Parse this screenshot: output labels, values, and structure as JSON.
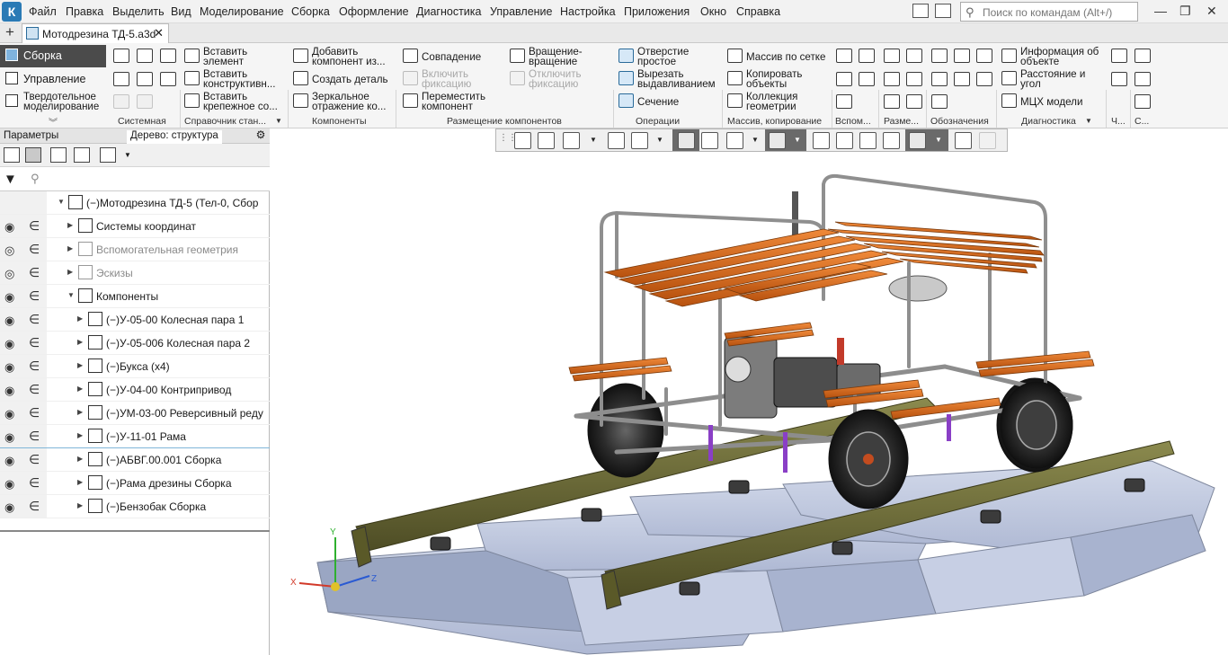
{
  "menubar": {
    "items": [
      "Файл",
      "Правка",
      "Выделить",
      "Вид",
      "Моделирование",
      "Сборка",
      "Оформление",
      "Диагностика",
      "Управление",
      "Настройка",
      "Приложения",
      "Окно",
      "Справка"
    ],
    "search_placeholder": "Поиск по командам (Alt+/)"
  },
  "tabs": {
    "document": "Мотодрезина ТД-5.a3d"
  },
  "modes": {
    "items": [
      "Сборка",
      "Управление",
      "Твердотельное моделирование"
    ]
  },
  "ribbon": {
    "insert_element": "Вставить элемент",
    "insert_construct": "Вставить конструктивн...",
    "insert_fastener": "Вставить крепежное со...",
    "add_component": "Добавить компонент из...",
    "create_part": "Создать деталь",
    "mirror_copy": "Зеркальное отражение ко...",
    "coincidence": "Совпадение",
    "enable_fix": "Включить фиксацию",
    "move_component": "Переместить компонент",
    "rotate": "Вращение-вращение",
    "disable_fix": "Отключить фиксацию",
    "simple_hole": "Отверстие простое",
    "cut_extrude": "Вырезать выдавливанием",
    "section": "Сечение",
    "grid_array": "Массив по сетке",
    "copy_objects": "Копировать объекты",
    "geometry_collection": "Коллекция геометрии",
    "object_info": "Информация об объекте",
    "distance_angle": "Расстояние и угол",
    "mass_props": "МЦХ модели",
    "groups": [
      "Системная",
      "Справочник стан...",
      "Компоненты",
      "Размещение компонентов",
      "Операции",
      "Массив, копирование",
      "Вспом...",
      "Разме...",
      "Обозначения",
      "Диагностика",
      "Ч...",
      "С..."
    ]
  },
  "left_panel": {
    "tab_params": "Параметры",
    "tab_tree": "Дерево: структура",
    "tree": [
      {
        "label": "(−)Мотодрезина ТД-5 (Тел-0, Сбор",
        "level": 0,
        "expanded": true
      },
      {
        "label": "Системы координат",
        "level": 1
      },
      {
        "label": "Вспомогательная геометрия",
        "level": 1,
        "grey": true
      },
      {
        "label": "Эскизы",
        "level": 1,
        "grey": true
      },
      {
        "label": "Компоненты",
        "level": 1,
        "expanded": true
      },
      {
        "label": "(−)У-05-00 Колесная пара 1",
        "level": 2
      },
      {
        "label": "(−)У-05-006 Колесная пара 2",
        "level": 2
      },
      {
        "label": "(−)Букса (x4)",
        "level": 2
      },
      {
        "label": "(−)У-04-00 Контрипривод",
        "level": 2
      },
      {
        "label": "(−)УМ-03-00 Реверсивный реду",
        "level": 2
      },
      {
        "label": "(−)У-11-01 Рама",
        "level": 2
      },
      {
        "label": "(−)АБВГ.00.001 Сборка",
        "level": 2
      },
      {
        "label": "(−)Рама дрезины Сборка",
        "level": 2
      },
      {
        "label": "(−)Бензобак Сборка",
        "level": 2
      }
    ]
  },
  "viewport": {
    "axes": {
      "x": "X",
      "y": "Y",
      "z": "Z"
    },
    "colors": {
      "rail": "#6f6e3a",
      "sleeper": "#b7c2dd",
      "slats": "#d8661c",
      "frame": "#9a9a9a",
      "wheel": "#2a2a2a"
    }
  }
}
